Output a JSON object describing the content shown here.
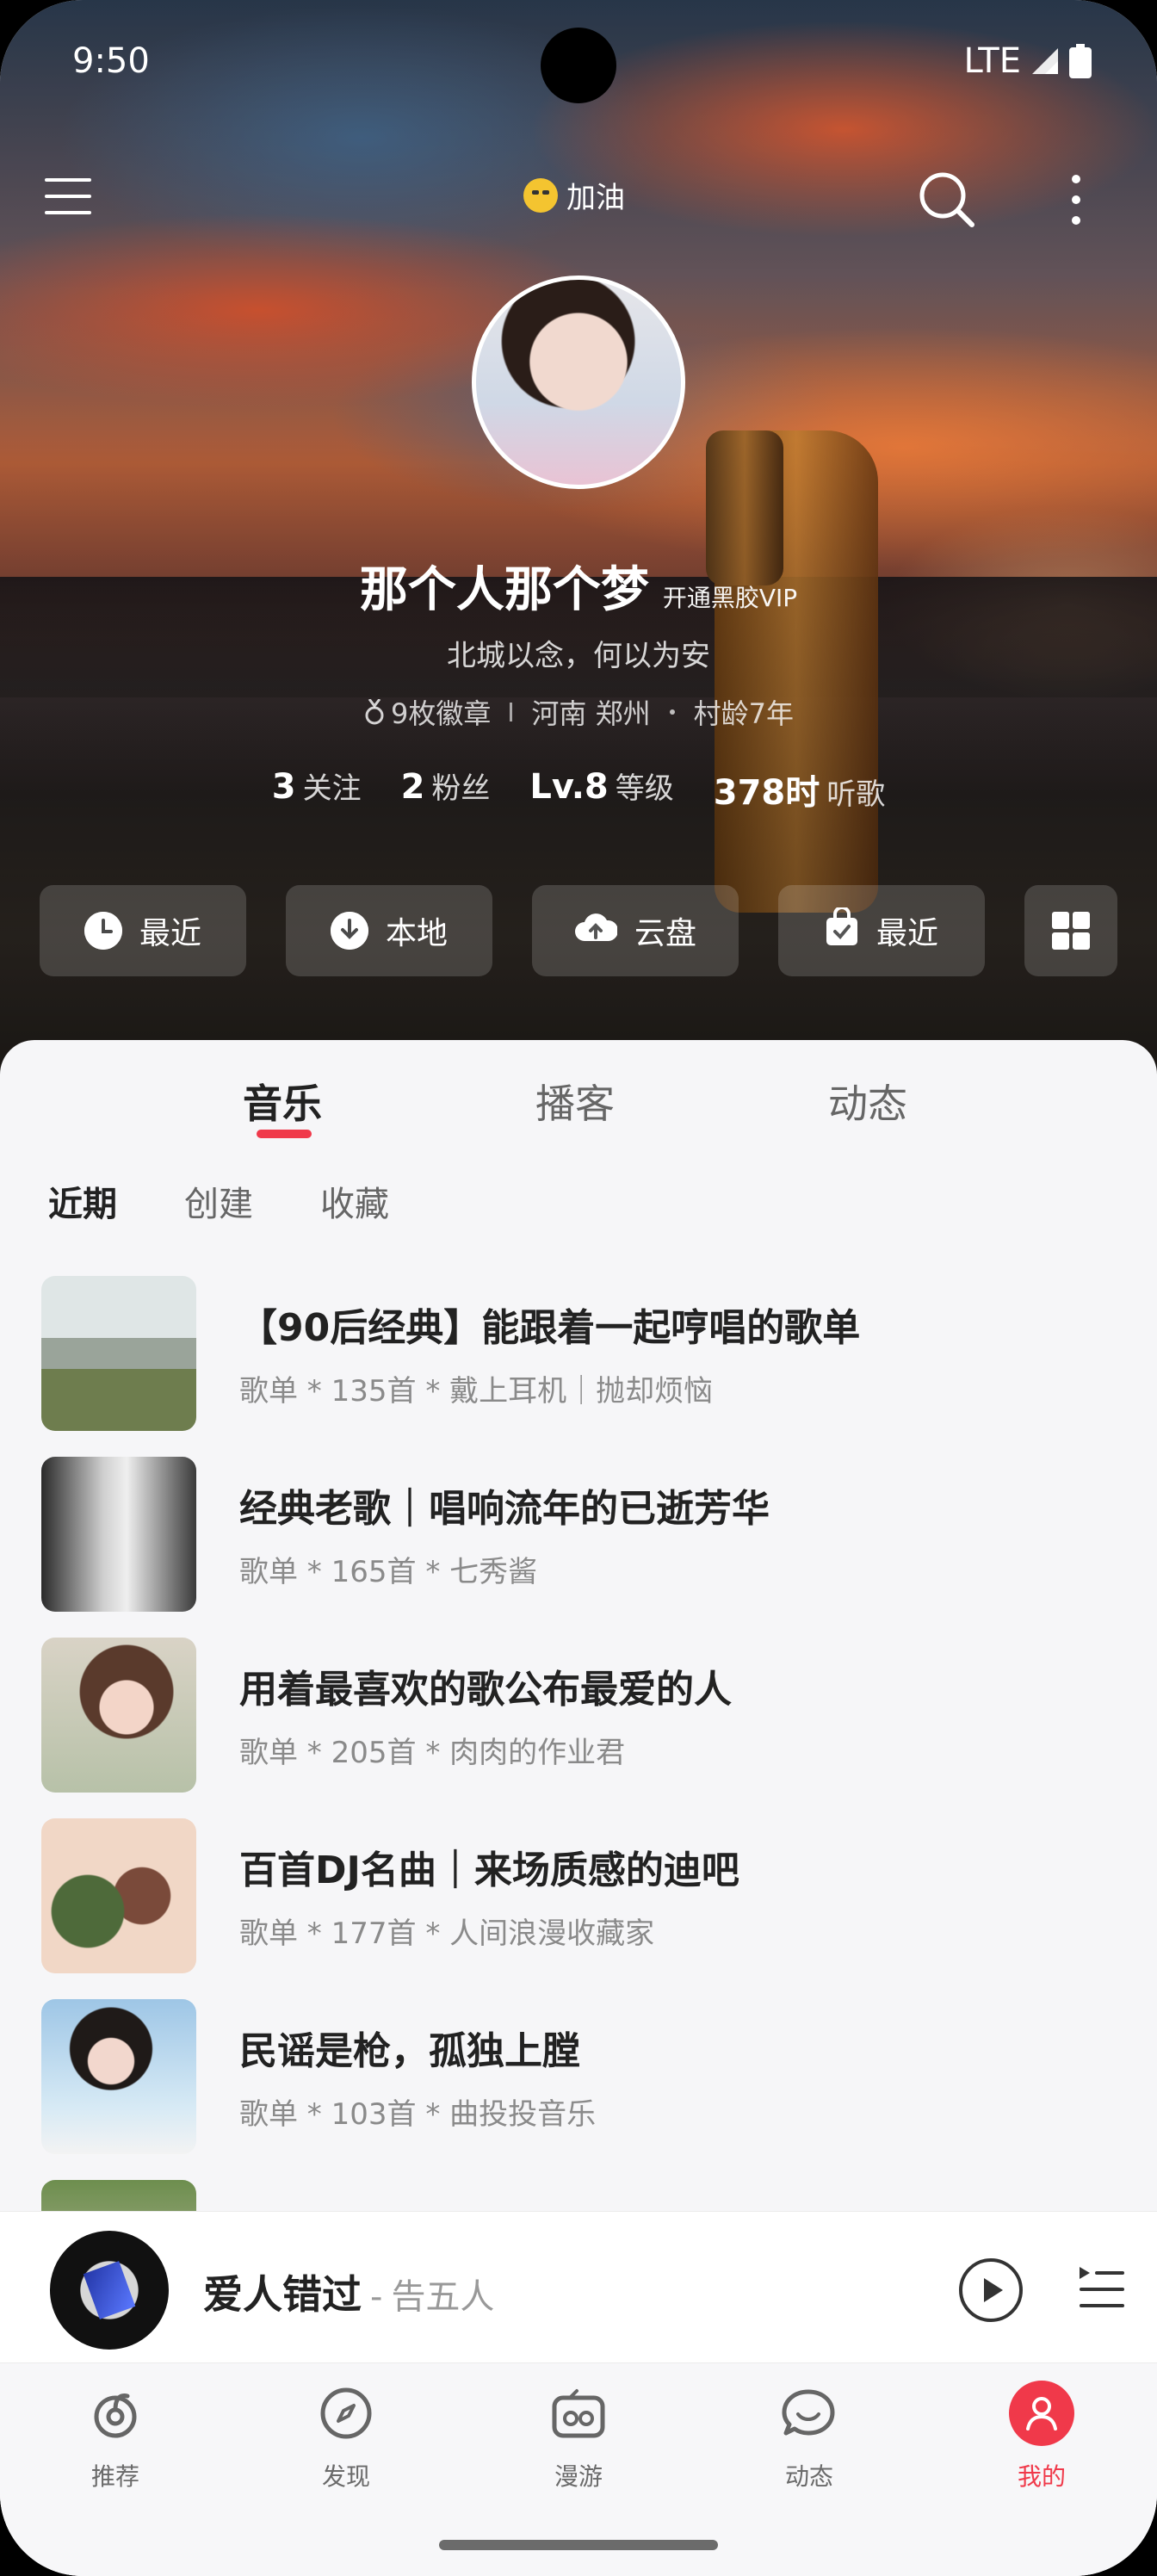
{
  "status_bar": {
    "time": "9:50",
    "network": "LTE"
  },
  "header": {
    "cheer_label": "加油"
  },
  "profile": {
    "username": "那个人那个梦",
    "vip_label": "开通黑胶VIP",
    "signature": "北城以念，何以为安",
    "badges": "9枚徽章",
    "location": "河南 郑州",
    "village_age": "村龄7年",
    "stats": [
      {
        "value": "3",
        "label": "关注"
      },
      {
        "value": "2",
        "label": "粉丝"
      },
      {
        "value": "Lv.8",
        "label": "等级"
      },
      {
        "value": "378时",
        "label": "听歌"
      }
    ]
  },
  "quick_actions": [
    {
      "label": "最近",
      "icon": "clock-icon"
    },
    {
      "label": "本地",
      "icon": "download-icon"
    },
    {
      "label": "云盘",
      "icon": "cloud-upload-icon"
    },
    {
      "label": "最近",
      "icon": "shopping-bag-icon"
    }
  ],
  "tabs": [
    {
      "label": "音乐",
      "active": true
    },
    {
      "label": "播客",
      "active": false
    },
    {
      "label": "动态",
      "active": false
    }
  ],
  "subtabs": [
    {
      "label": "近期",
      "active": true
    },
    {
      "label": "创建",
      "active": false
    },
    {
      "label": "收藏",
      "active": false
    }
  ],
  "playlists": [
    {
      "title": "【90后经典】能跟着一起哼唱的歌单",
      "subtitle": "歌单 * 135首 * 戴上耳机｜抛却烦恼"
    },
    {
      "title": "经典老歌｜唱响流年的已逝芳华",
      "subtitle": "歌单 * 165首 * 七秀酱"
    },
    {
      "title": "用着最喜欢的歌公布最爱的人",
      "subtitle": "歌单 * 205首 * 肉肉的作业君"
    },
    {
      "title": "百首DJ名曲｜来场质感的迪吧",
      "subtitle": "歌单 * 177首 * 人间浪漫收藏家"
    },
    {
      "title": "民谣是枪，孤独上膛",
      "subtitle": "歌单 * 103首 * 曲投投音乐"
    }
  ],
  "player": {
    "song": "爱人错过",
    "separator": "-",
    "artist": "告五人"
  },
  "nav": [
    {
      "label": "推荐",
      "icon": "netease-icon"
    },
    {
      "label": "发现",
      "icon": "compass-icon"
    },
    {
      "label": "漫游",
      "icon": "radio-icon"
    },
    {
      "label": "动态",
      "icon": "chat-icon"
    },
    {
      "label": "我的",
      "icon": "user-icon",
      "active": true
    }
  ],
  "colors": {
    "accent": "#f0394a"
  }
}
